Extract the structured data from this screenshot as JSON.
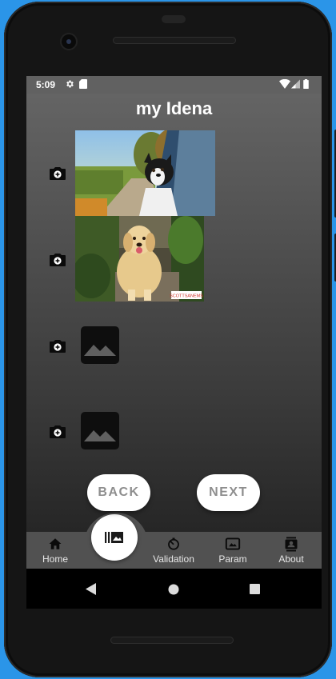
{
  "status_bar": {
    "time": "5:09"
  },
  "app": {
    "title": "my Idena"
  },
  "flips": [
    {
      "slot": 1,
      "state": "photo",
      "image": "dog-in-car-window"
    },
    {
      "slot": 2,
      "state": "photo",
      "image": "golden-retriever",
      "watermark": "SCOTTSANEMS"
    },
    {
      "slot": 3,
      "state": "empty",
      "image": "image-placeholder-icon"
    },
    {
      "slot": 4,
      "state": "empty",
      "image": "image-placeholder-icon"
    }
  ],
  "buttons": {
    "back": "BACK",
    "next": "NEXT"
  },
  "bottom_nav": {
    "home": "Home",
    "validation": "Validation",
    "param": "Param",
    "about": "About",
    "active": "flips"
  },
  "colors": {
    "background": "#2b95e8",
    "nav": "#515151",
    "status": "#616161"
  }
}
